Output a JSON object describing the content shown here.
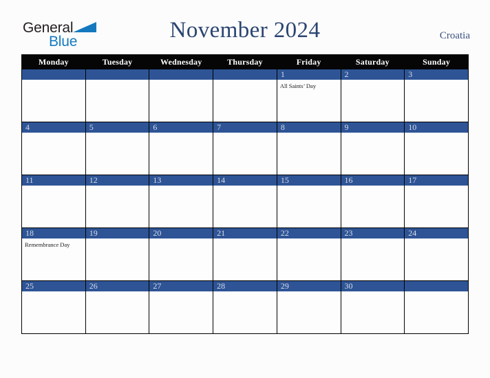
{
  "header": {
    "logo": {
      "text_top": "General",
      "text_bottom": "Blue",
      "triangle_icon": "triangle-icon",
      "color_top": "#231f20",
      "color_bottom": "#1479bf"
    },
    "title": "November 2024",
    "country": "Croatia",
    "title_color": "#2b4570"
  },
  "calendar": {
    "weekday_headers": [
      "Monday",
      "Tuesday",
      "Wednesday",
      "Thursday",
      "Friday",
      "Saturday",
      "Sunday"
    ],
    "header_bg": "#060606",
    "header_text_color": "#ffffff",
    "daynum_bg": "#2e5496",
    "daynum_text_color": "#d9dde6",
    "cell_bg": "#fdfdfd",
    "border_color": "#000000",
    "weeks": [
      [
        {
          "day": "",
          "holiday": ""
        },
        {
          "day": "",
          "holiday": ""
        },
        {
          "day": "",
          "holiday": ""
        },
        {
          "day": "",
          "holiday": ""
        },
        {
          "day": "1",
          "holiday": "All Saints’ Day"
        },
        {
          "day": "2",
          "holiday": ""
        },
        {
          "day": "3",
          "holiday": ""
        }
      ],
      [
        {
          "day": "4",
          "holiday": ""
        },
        {
          "day": "5",
          "holiday": ""
        },
        {
          "day": "6",
          "holiday": ""
        },
        {
          "day": "7",
          "holiday": ""
        },
        {
          "day": "8",
          "holiday": ""
        },
        {
          "day": "9",
          "holiday": ""
        },
        {
          "day": "10",
          "holiday": ""
        }
      ],
      [
        {
          "day": "11",
          "holiday": ""
        },
        {
          "day": "12",
          "holiday": ""
        },
        {
          "day": "13",
          "holiday": ""
        },
        {
          "day": "14",
          "holiday": ""
        },
        {
          "day": "15",
          "holiday": ""
        },
        {
          "day": "16",
          "holiday": ""
        },
        {
          "day": "17",
          "holiday": ""
        }
      ],
      [
        {
          "day": "18",
          "holiday": "Remembrance Day"
        },
        {
          "day": "19",
          "holiday": ""
        },
        {
          "day": "20",
          "holiday": ""
        },
        {
          "day": "21",
          "holiday": ""
        },
        {
          "day": "22",
          "holiday": ""
        },
        {
          "day": "23",
          "holiday": ""
        },
        {
          "day": "24",
          "holiday": ""
        }
      ],
      [
        {
          "day": "25",
          "holiday": ""
        },
        {
          "day": "26",
          "holiday": ""
        },
        {
          "day": "27",
          "holiday": ""
        },
        {
          "day": "28",
          "holiday": ""
        },
        {
          "day": "29",
          "holiday": ""
        },
        {
          "day": "30",
          "holiday": ""
        },
        {
          "day": "",
          "holiday": ""
        }
      ]
    ]
  }
}
